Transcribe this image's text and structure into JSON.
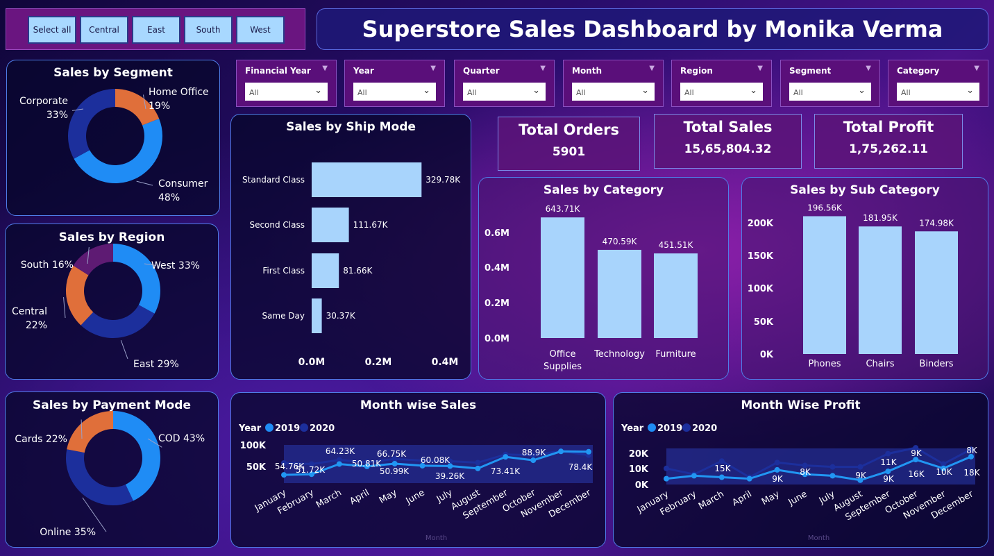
{
  "title": "Superstore Sales Dashboard by Monika Verma",
  "region_buttons": [
    "Select all",
    "Central",
    "East",
    "South",
    "West"
  ],
  "slicers": [
    {
      "label": "Financial Year",
      "value": "All"
    },
    {
      "label": "Year",
      "value": "All"
    },
    {
      "label": "Quarter",
      "value": "All"
    },
    {
      "label": "Month",
      "value": "All"
    },
    {
      "label": "Region",
      "value": "All"
    },
    {
      "label": "Segment",
      "value": "All"
    },
    {
      "label": "Category",
      "value": "All"
    }
  ],
  "kpis": {
    "orders": {
      "label": "Total Orders",
      "value": "5901"
    },
    "sales": {
      "label": "Total Sales",
      "value": "15,65,804.32"
    },
    "profit": {
      "label": "Total Profit",
      "value": "1,75,262.11"
    }
  },
  "colors": {
    "light_blue": "#a8d4fc",
    "blue": "#1f8cf5",
    "navy": "#1c2f9c",
    "orange": "#e06f3a",
    "purple": "#5e1b73"
  },
  "chart_data": [
    {
      "id": "segment",
      "type": "pie",
      "title": "Sales by Segment",
      "donut": true,
      "slices": [
        {
          "label": "Home Office",
          "pct_label": "19%",
          "value": 19,
          "color": "#e06f3a"
        },
        {
          "label": "Consumer",
          "pct_label": "48%",
          "value": 48,
          "color": "#1f8cf5"
        },
        {
          "label": "Corporate",
          "pct_label": "33%",
          "value": 33,
          "color": "#1c2f9c"
        }
      ]
    },
    {
      "id": "region",
      "type": "pie",
      "title": "Sales by Region",
      "donut": true,
      "slices": [
        {
          "label": "West 33%",
          "value": 33,
          "color": "#1f8cf5"
        },
        {
          "label": "East 29%",
          "value": 29,
          "color": "#1c2f9c"
        },
        {
          "label": "Central",
          "pct_label": "22%",
          "value": 22,
          "color": "#e06f3a"
        },
        {
          "label": "South 16%",
          "value": 16,
          "color": "#5e1b73"
        }
      ]
    },
    {
      "id": "payment",
      "type": "pie",
      "title": "Sales by Payment Mode",
      "donut": true,
      "slices": [
        {
          "label": "COD 43%",
          "value": 43,
          "color": "#1f8cf5"
        },
        {
          "label": "Online 35%",
          "value": 35,
          "color": "#1c2f9c"
        },
        {
          "label": "Cards 22%",
          "value": 22,
          "color": "#e06f3a"
        }
      ]
    },
    {
      "id": "shipmode",
      "type": "bar",
      "orientation": "horizontal",
      "title": "Sales by Ship Mode",
      "categories": [
        "Standard Class",
        "Second Class",
        "First Class",
        "Same Day"
      ],
      "values": [
        329.78,
        111.67,
        81.66,
        30.37
      ],
      "value_labels": [
        "329.78K",
        "111.67K",
        "81.66K",
        "30.37K"
      ],
      "xticks": [
        "0.0M",
        "0.2M",
        "0.4M"
      ],
      "xlim": [
        0,
        400
      ]
    },
    {
      "id": "category",
      "type": "bar",
      "title": "Sales by Category",
      "categories": [
        "Office Supplies",
        "Technology",
        "Furniture"
      ],
      "values": [
        643.71,
        470.59,
        451.51
      ],
      "value_labels": [
        "643.71K",
        "470.59K",
        "451.51K"
      ],
      "yticks": [
        "0.6M",
        "0.4M",
        "0.2M",
        "0.0M"
      ],
      "ylim": [
        0,
        600
      ]
    },
    {
      "id": "subcategory",
      "type": "bar",
      "title": "Sales by Sub Category",
      "categories": [
        "Phones",
        "Chairs",
        "Binders"
      ],
      "values": [
        196.56,
        181.95,
        174.98
      ],
      "value_labels": [
        "196.56K",
        "181.95K",
        "174.98K"
      ],
      "yticks": [
        "200K",
        "150K",
        "100K",
        "50K",
        "0K"
      ],
      "ylim": [
        0,
        200
      ]
    },
    {
      "id": "monthsales",
      "type": "line",
      "title": "Month wise Sales",
      "xlabel": "Month",
      "legend": {
        "title": "Year",
        "items": [
          "2019",
          "2020"
        ]
      },
      "categories": [
        "January",
        "February",
        "March",
        "April",
        "May",
        "June",
        "July",
        "August",
        "September",
        "October",
        "November",
        "December"
      ],
      "series": [
        {
          "name": "2019",
          "values": [
            20,
            22,
            52,
            45,
            53,
            47,
            46,
            39,
            73,
            63,
            89,
            88
          ]
        },
        {
          "name": "2020",
          "values": [
            55,
            52,
            64,
            57,
            67,
            62,
            60,
            56,
            80,
            78,
            90,
            78
          ]
        }
      ],
      "point_labels": [
        "54.76K",
        "51.72K",
        "64.23K",
        "50.81K",
        "66.75K",
        "50.99K",
        "60.08K",
        "39.26K",
        "73.41K",
        "88.9K",
        "78.4K"
      ],
      "yticks": [
        "100K",
        "50K"
      ],
      "ylim": [
        0,
        110
      ]
    },
    {
      "id": "monthprofit",
      "type": "line",
      "title": "Month Wise Profit",
      "xlabel": "Month",
      "legend": {
        "title": "Year",
        "items": [
          "2019",
          "2020"
        ]
      },
      "categories": [
        "January",
        "February",
        "March",
        "April",
        "May",
        "June",
        "July",
        "August",
        "September",
        "October",
        "November",
        "December"
      ],
      "series": [
        {
          "name": "2019",
          "values": [
            3,
            5,
            4,
            3,
            9,
            6,
            5,
            2,
            8,
            16,
            10,
            18
          ]
        },
        {
          "name": "2020",
          "values": [
            10,
            6,
            15,
            4,
            14,
            12,
            11,
            11,
            20,
            24,
            13,
            23
          ]
        }
      ],
      "point_labels": [
        "15K",
        "9K",
        "8K",
        "9K",
        "11K",
        "9K",
        "9K",
        "16K",
        "10K",
        "18K",
        "8K"
      ],
      "yticks": [
        "20K",
        "10K",
        "0K"
      ],
      "ylim": [
        0,
        25
      ]
    }
  ]
}
